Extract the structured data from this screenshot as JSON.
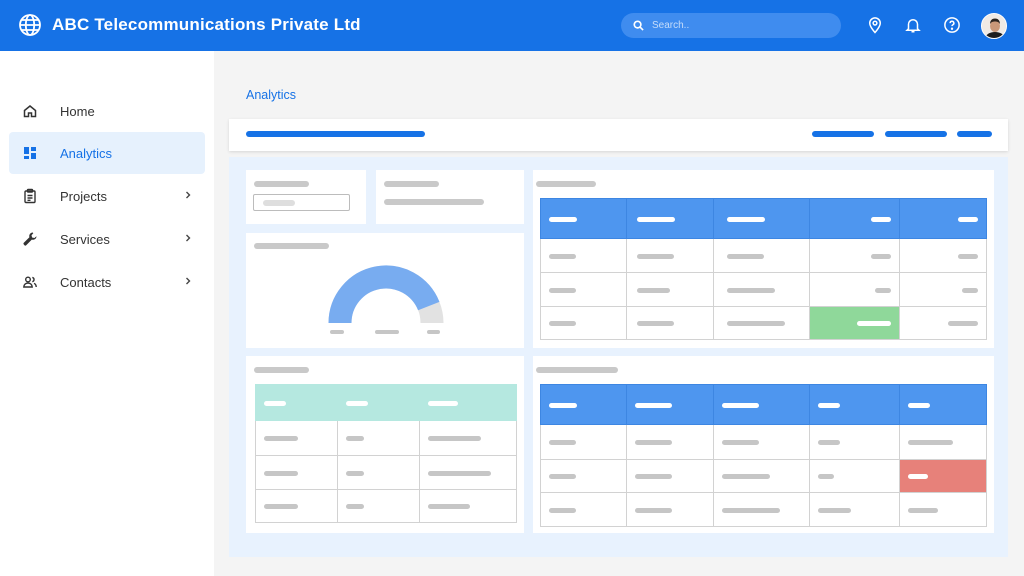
{
  "header": {
    "title": "ABC Telecommunications Private Ltd",
    "logo_icon": "globe-icon",
    "search_placeholder": "Search..",
    "icons": [
      "location-pin-icon",
      "bell-icon",
      "help-icon"
    ],
    "avatar": "user-avatar",
    "color": "#1672e6"
  },
  "sidebar": {
    "items": [
      {
        "label": "Home",
        "icon": "home-icon",
        "has_submenu": false,
        "active": false
      },
      {
        "label": "Analytics",
        "icon": "dashboard-icon",
        "has_submenu": false,
        "active": true
      },
      {
        "label": "Projects",
        "icon": "clipboard-icon",
        "has_submenu": true,
        "active": false
      },
      {
        "label": "Services",
        "icon": "wrench-icon",
        "has_submenu": true,
        "active": false
      },
      {
        "label": "Contacts",
        "icon": "people-icon",
        "has_submenu": true,
        "active": false
      }
    ]
  },
  "main": {
    "page_title": "Analytics",
    "gauge": {
      "level_fraction": 0.88,
      "fill_color": "#78acf0",
      "track_color": "#e2e2e2"
    },
    "status_colors": {
      "success": "#8fd89a",
      "danger": "#e7817a",
      "table_header": "#4e96ef",
      "teal_header": "#b5e8e0"
    }
  }
}
